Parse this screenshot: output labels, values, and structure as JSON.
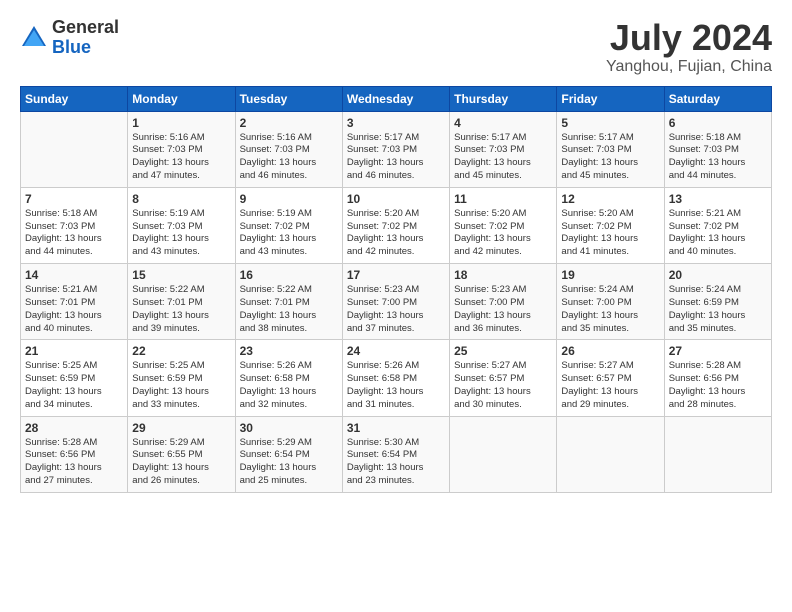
{
  "header": {
    "logo_general": "General",
    "logo_blue": "Blue",
    "title": "July 2024",
    "subtitle": "Yanghou, Fujian, China"
  },
  "days_of_week": [
    "Sunday",
    "Monday",
    "Tuesday",
    "Wednesday",
    "Thursday",
    "Friday",
    "Saturday"
  ],
  "weeks": [
    [
      {
        "day": "",
        "info": ""
      },
      {
        "day": "1",
        "info": "Sunrise: 5:16 AM\nSunset: 7:03 PM\nDaylight: 13 hours\nand 47 minutes."
      },
      {
        "day": "2",
        "info": "Sunrise: 5:16 AM\nSunset: 7:03 PM\nDaylight: 13 hours\nand 46 minutes."
      },
      {
        "day": "3",
        "info": "Sunrise: 5:17 AM\nSunset: 7:03 PM\nDaylight: 13 hours\nand 46 minutes."
      },
      {
        "day": "4",
        "info": "Sunrise: 5:17 AM\nSunset: 7:03 PM\nDaylight: 13 hours\nand 45 minutes."
      },
      {
        "day": "5",
        "info": "Sunrise: 5:17 AM\nSunset: 7:03 PM\nDaylight: 13 hours\nand 45 minutes."
      },
      {
        "day": "6",
        "info": "Sunrise: 5:18 AM\nSunset: 7:03 PM\nDaylight: 13 hours\nand 44 minutes."
      }
    ],
    [
      {
        "day": "7",
        "info": "Sunrise: 5:18 AM\nSunset: 7:03 PM\nDaylight: 13 hours\nand 44 minutes."
      },
      {
        "day": "8",
        "info": "Sunrise: 5:19 AM\nSunset: 7:03 PM\nDaylight: 13 hours\nand 43 minutes."
      },
      {
        "day": "9",
        "info": "Sunrise: 5:19 AM\nSunset: 7:02 PM\nDaylight: 13 hours\nand 43 minutes."
      },
      {
        "day": "10",
        "info": "Sunrise: 5:20 AM\nSunset: 7:02 PM\nDaylight: 13 hours\nand 42 minutes."
      },
      {
        "day": "11",
        "info": "Sunrise: 5:20 AM\nSunset: 7:02 PM\nDaylight: 13 hours\nand 42 minutes."
      },
      {
        "day": "12",
        "info": "Sunrise: 5:20 AM\nSunset: 7:02 PM\nDaylight: 13 hours\nand 41 minutes."
      },
      {
        "day": "13",
        "info": "Sunrise: 5:21 AM\nSunset: 7:02 PM\nDaylight: 13 hours\nand 40 minutes."
      }
    ],
    [
      {
        "day": "14",
        "info": "Sunrise: 5:21 AM\nSunset: 7:01 PM\nDaylight: 13 hours\nand 40 minutes."
      },
      {
        "day": "15",
        "info": "Sunrise: 5:22 AM\nSunset: 7:01 PM\nDaylight: 13 hours\nand 39 minutes."
      },
      {
        "day": "16",
        "info": "Sunrise: 5:22 AM\nSunset: 7:01 PM\nDaylight: 13 hours\nand 38 minutes."
      },
      {
        "day": "17",
        "info": "Sunrise: 5:23 AM\nSunset: 7:00 PM\nDaylight: 13 hours\nand 37 minutes."
      },
      {
        "day": "18",
        "info": "Sunrise: 5:23 AM\nSunset: 7:00 PM\nDaylight: 13 hours\nand 36 minutes."
      },
      {
        "day": "19",
        "info": "Sunrise: 5:24 AM\nSunset: 7:00 PM\nDaylight: 13 hours\nand 35 minutes."
      },
      {
        "day": "20",
        "info": "Sunrise: 5:24 AM\nSunset: 6:59 PM\nDaylight: 13 hours\nand 35 minutes."
      }
    ],
    [
      {
        "day": "21",
        "info": "Sunrise: 5:25 AM\nSunset: 6:59 PM\nDaylight: 13 hours\nand 34 minutes."
      },
      {
        "day": "22",
        "info": "Sunrise: 5:25 AM\nSunset: 6:59 PM\nDaylight: 13 hours\nand 33 minutes."
      },
      {
        "day": "23",
        "info": "Sunrise: 5:26 AM\nSunset: 6:58 PM\nDaylight: 13 hours\nand 32 minutes."
      },
      {
        "day": "24",
        "info": "Sunrise: 5:26 AM\nSunset: 6:58 PM\nDaylight: 13 hours\nand 31 minutes."
      },
      {
        "day": "25",
        "info": "Sunrise: 5:27 AM\nSunset: 6:57 PM\nDaylight: 13 hours\nand 30 minutes."
      },
      {
        "day": "26",
        "info": "Sunrise: 5:27 AM\nSunset: 6:57 PM\nDaylight: 13 hours\nand 29 minutes."
      },
      {
        "day": "27",
        "info": "Sunrise: 5:28 AM\nSunset: 6:56 PM\nDaylight: 13 hours\nand 28 minutes."
      }
    ],
    [
      {
        "day": "28",
        "info": "Sunrise: 5:28 AM\nSunset: 6:56 PM\nDaylight: 13 hours\nand 27 minutes."
      },
      {
        "day": "29",
        "info": "Sunrise: 5:29 AM\nSunset: 6:55 PM\nDaylight: 13 hours\nand 26 minutes."
      },
      {
        "day": "30",
        "info": "Sunrise: 5:29 AM\nSunset: 6:54 PM\nDaylight: 13 hours\nand 25 minutes."
      },
      {
        "day": "31",
        "info": "Sunrise: 5:30 AM\nSunset: 6:54 PM\nDaylight: 13 hours\nand 23 minutes."
      },
      {
        "day": "",
        "info": ""
      },
      {
        "day": "",
        "info": ""
      },
      {
        "day": "",
        "info": ""
      }
    ]
  ]
}
